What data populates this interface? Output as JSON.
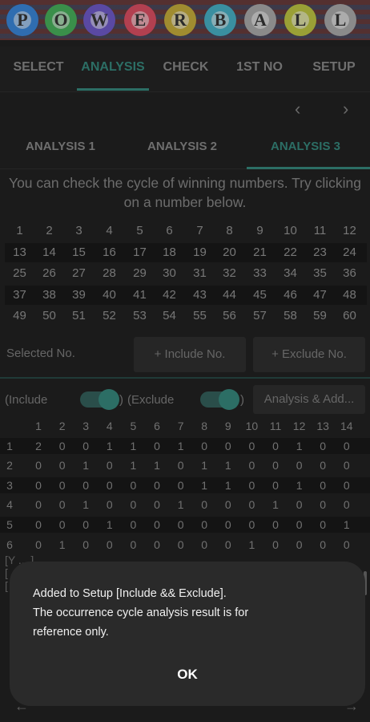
{
  "banner": {
    "letters": [
      "P",
      "O",
      "W",
      "E",
      "R",
      "B",
      "A",
      "L",
      "L"
    ],
    "ball_colors": [
      "#2f6db0",
      "#3a8f4a",
      "#5a49a3",
      "#b24050",
      "#a08c30",
      "#3a8fa0",
      "#8a8a8a",
      "#9aa036",
      "#8a8a8a"
    ]
  },
  "topnav": {
    "tabs": [
      "SELECT",
      "ANALYSIS",
      "CHECK",
      "1ST NO",
      "SETUP"
    ],
    "active": "ANALYSIS"
  },
  "pager": {
    "prev": "‹",
    "next": "›"
  },
  "subtabs": {
    "items": [
      "ANALYSIS 1",
      "ANALYSIS 2",
      "ANALYSIS 3"
    ],
    "active": "ANALYSIS 3"
  },
  "hint": "You can check the cycle of winning numbers. Try clicking on a number below.",
  "number_grid": [
    [
      "1",
      "2",
      "3",
      "4",
      "5",
      "6",
      "7",
      "8",
      "9",
      "10",
      "11",
      "12"
    ],
    [
      "13",
      "14",
      "15",
      "16",
      "17",
      "18",
      "19",
      "20",
      "21",
      "22",
      "23",
      "24"
    ],
    [
      "25",
      "26",
      "27",
      "28",
      "29",
      "30",
      "31",
      "32",
      "33",
      "34",
      "35",
      "36"
    ],
    [
      "37",
      "38",
      "39",
      "40",
      "41",
      "42",
      "43",
      "44",
      "45",
      "46",
      "47",
      "48"
    ],
    [
      "49",
      "50",
      "51",
      "52",
      "53",
      "54",
      "55",
      "56",
      "57",
      "58",
      "59",
      "60"
    ]
  ],
  "selection": {
    "label": "Selected No.",
    "include_btn": "+ Include No.",
    "exclude_btn": "+ Exclude No."
  },
  "toggles": {
    "include_label": "(Include",
    "include_close": ")",
    "exclude_label": "(Exclude",
    "exclude_close": ")",
    "analysis_btn": "Analysis & Add..."
  },
  "matrix": {
    "header": [
      "1",
      "2",
      "3",
      "4",
      "5",
      "6",
      "7",
      "8",
      "9",
      "10",
      "11",
      "12",
      "13",
      "14"
    ],
    "rows": [
      {
        "label": "1",
        "values": [
          "2",
          "0",
          "0",
          "1",
          "1",
          "0",
          "1",
          "0",
          "0",
          "0",
          "0",
          "1",
          "0",
          "0"
        ]
      },
      {
        "label": "2",
        "values": [
          "0",
          "0",
          "1",
          "0",
          "1",
          "1",
          "0",
          "1",
          "1",
          "0",
          "0",
          "0",
          "0",
          "0"
        ]
      },
      {
        "label": "3",
        "values": [
          "0",
          "0",
          "0",
          "0",
          "0",
          "0",
          "0",
          "1",
          "1",
          "0",
          "0",
          "1",
          "0",
          "0"
        ]
      },
      {
        "label": "4",
        "values": [
          "0",
          "0",
          "1",
          "0",
          "0",
          "0",
          "1",
          "0",
          "0",
          "0",
          "1",
          "0",
          "0",
          "0"
        ]
      },
      {
        "label": "5",
        "values": [
          "0",
          "0",
          "0",
          "1",
          "0",
          "0",
          "0",
          "0",
          "0",
          "0",
          "0",
          "0",
          "0",
          "1"
        ]
      },
      {
        "label": "6",
        "values": [
          "0",
          "1",
          "0",
          "0",
          "0",
          "0",
          "0",
          "0",
          "0",
          "1",
          "0",
          "0",
          "0",
          "0"
        ]
      }
    ]
  },
  "behind_text": [
    "[Y ... ]",
    "[",
    "["
  ],
  "dialog": {
    "message_lines": [
      "Added to Setup [Include && Exclude].",
      "The occurrence cycle analysis result is for",
      "reference only."
    ],
    "ok": "OK"
  },
  "bottomnav": {
    "prev": "←",
    "next": "→"
  }
}
